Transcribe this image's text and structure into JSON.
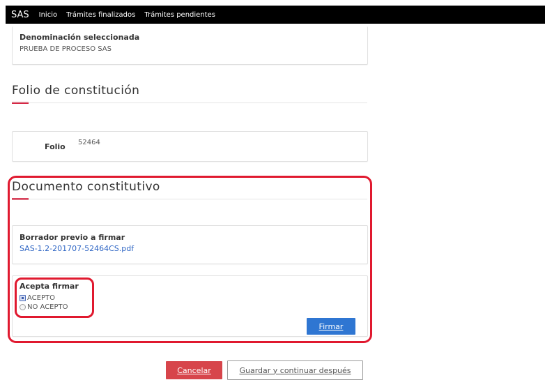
{
  "nav": {
    "brand": "SAS",
    "items": [
      "Inicio",
      "Trámites finalizados",
      "Trámites pendientes"
    ]
  },
  "denominacion": {
    "label": "Denominación seleccionada",
    "value": "PRUEBA DE PROCESO SAS"
  },
  "folio_section": {
    "title": "Folio de constitución",
    "label": "Folio",
    "value": "52464"
  },
  "documento": {
    "title": "Documento constitutivo",
    "borrador_label": "Borrador previo a firmar",
    "file_link": "SAS-1.2-201707-52464CS.pdf",
    "acepta_label": "Acepta firmar",
    "options": [
      "ACEPTO",
      "NO ACEPTO"
    ],
    "selected": "ACEPTO",
    "firmar_button": "Firmar"
  },
  "footer": {
    "cancel_button": "Cancelar",
    "save_button": "Guardar y continuar después"
  },
  "colors": {
    "accent_red": "#d61b3a",
    "highlight_red": "#e0192f",
    "primary_blue": "#2f76d2",
    "danger": "#d7454b",
    "navbar": "#000000"
  }
}
